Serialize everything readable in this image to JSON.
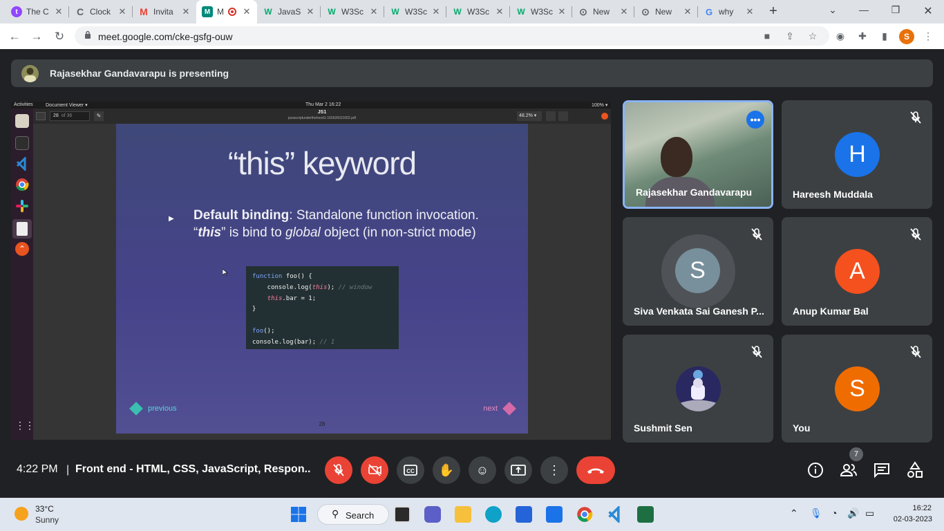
{
  "browser": {
    "tabs": [
      {
        "title": "The C",
        "icon": "twitch-icon",
        "color": "#9146ff",
        "letter": "t"
      },
      {
        "title": "Clock",
        "icon": "clockify-icon",
        "color": "#5f6368",
        "letter": "C"
      },
      {
        "title": "Invita",
        "icon": "gmail-icon",
        "color": "#ea4335",
        "letter": "M"
      },
      {
        "title": "M",
        "icon": "meet-icon",
        "color": "#00897b",
        "letter": "M",
        "active": true
      },
      {
        "title": "JavaS",
        "icon": "w3schools-icon",
        "color": "#04aa6d",
        "letter": "W"
      },
      {
        "title": "W3Sc",
        "icon": "w3schools-icon",
        "color": "#04aa6d",
        "letter": "W"
      },
      {
        "title": "W3Sc",
        "icon": "w3schools-icon",
        "color": "#04aa6d",
        "letter": "W"
      },
      {
        "title": "W3Sc",
        "icon": "w3schools-icon",
        "color": "#04aa6d",
        "letter": "W"
      },
      {
        "title": "W3Sc",
        "icon": "w3schools-icon",
        "color": "#04aa6d",
        "letter": "W"
      },
      {
        "title": "New",
        "icon": "chrome-icon",
        "color": "#5f6368",
        "letter": "⊙"
      },
      {
        "title": "New",
        "icon": "chrome-icon",
        "color": "#5f6368",
        "letter": "⊙"
      },
      {
        "title": "why",
        "icon": "google-icon",
        "color": "#4285f4",
        "letter": "G"
      }
    ],
    "url": "meet.google.com/cke-gsfg-ouw",
    "profile_letter": "S"
  },
  "meet": {
    "presenting_banner": "Rajasekhar Gandavarapu is presenting",
    "shared_screen": {
      "ubuntu_activities": "Activities",
      "ubuntu_app": "Document Viewer ▾",
      "ubuntu_clock": "Thu Mar 2  16:22",
      "doc_title": "JS1",
      "doc_file": "javascriptunderthehood1-160626021002.pdf",
      "page_num": "28",
      "page_total": "of 36",
      "zoom": "48.2% ▾",
      "battery": "100% ▾"
    },
    "slide": {
      "title": "“this” keyword",
      "bold_lead": "Default binding",
      "text_1": ": Standalone function invocation.",
      "quote_open": "“",
      "this_word": "this",
      "text_2": "” is bind to ",
      "global_word": "global",
      "text_3": " object (in non-strict mode)",
      "code": {
        "l1a": "function",
        "l1b": " foo() {",
        "l2a": "    console.log(",
        "l2b": "this",
        "l2c": ");",
        "l2d": " // window",
        "l3a": "    ",
        "l3b": "this",
        "l3c": ".bar = 1;",
        "l4": "}",
        "l6a": "foo",
        "l6b": "();",
        "l7a": "console.log(bar);",
        "l7b": " // 1"
      },
      "prev_label": "previous",
      "next_label": "next",
      "page_number": "28"
    },
    "participants": [
      {
        "name": "Rajasekhar Gandavarapu",
        "type": "video",
        "pinned": true
      },
      {
        "name": "Hareesh Muddala",
        "initial": "H",
        "color": "#1a73e8",
        "muted": true
      },
      {
        "name": "Siva Venkata Sai Ganesh P...",
        "initial": "S",
        "color": "#78909c",
        "muted": true,
        "speaking_ring": true
      },
      {
        "name": "Anup Kumar Bal",
        "initial": "A",
        "color": "#f4511e",
        "muted": true
      },
      {
        "name": "Sushmit Sen",
        "type": "image-avatar",
        "muted": true
      },
      {
        "name": "You",
        "initial": "S",
        "color": "#ef6c00",
        "muted": true
      }
    ],
    "bottom": {
      "time": "4:22 PM",
      "separator": "|",
      "meeting_title": "Front end - HTML, CSS, JavaScript, Respon...",
      "people_count": "7"
    }
  },
  "taskbar": {
    "temperature": "33°C",
    "weather": "Sunny",
    "search_label": "Search",
    "time": "16:22",
    "date": "02-03-2023"
  }
}
